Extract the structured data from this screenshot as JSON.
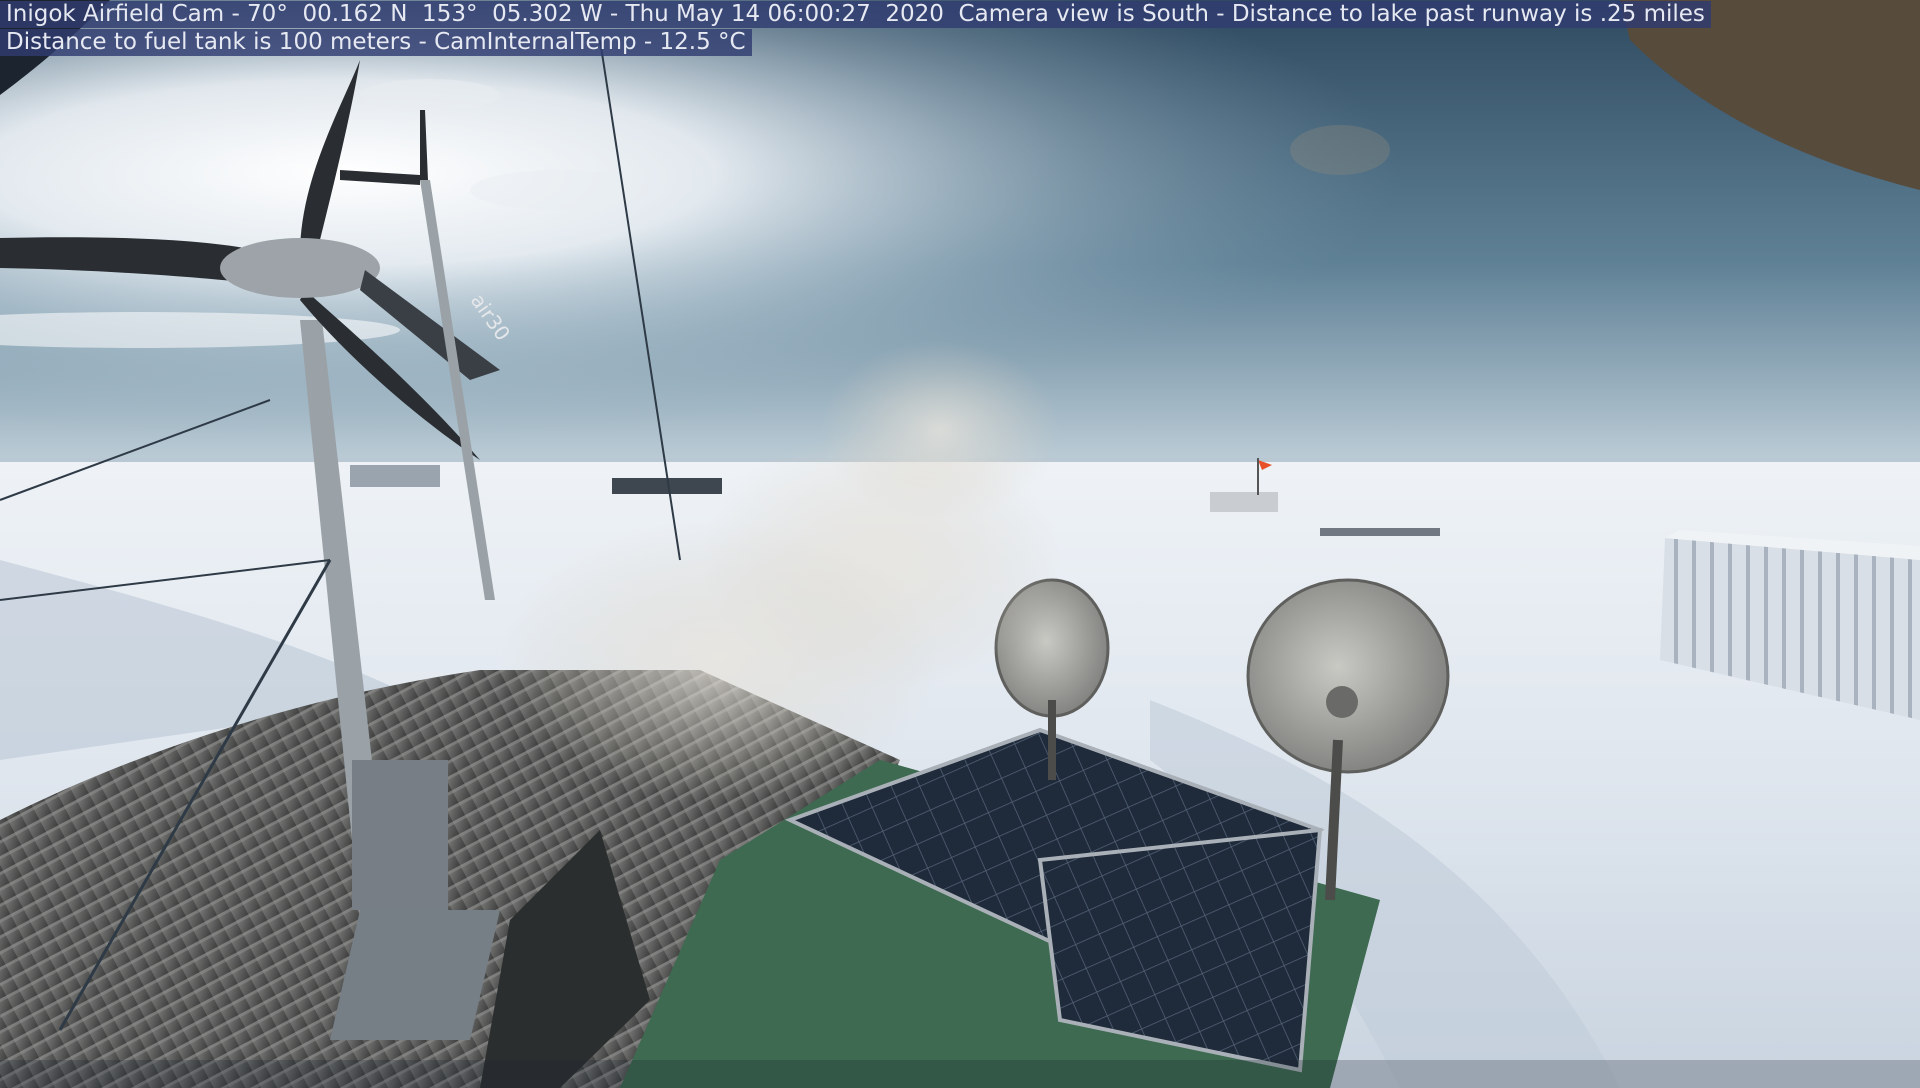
{
  "webcam": {
    "line1": "Inigok Airfield Cam - 70°  00.162 N  153°  05.302 W - Thu May 14 06:00:27  2020  Camera view is South - Distance to lake past runway is .25 miles",
    "line2": "Distance to fuel tank is 100 meters - CamInternalTemp - 12.5 °C"
  },
  "wind_turbine": {
    "nacelle_label": "air30"
  },
  "colors": {
    "overlay_background": "#303c70",
    "overlay_text": "#e6e9f2",
    "sky_top": "#36536a",
    "sky_glow": "#f4f7fb",
    "snow": "#e4e9f0",
    "windsock": "#e8502a",
    "roof_metal": "#6b6c6b",
    "roof_green": "#3f6a4f"
  }
}
